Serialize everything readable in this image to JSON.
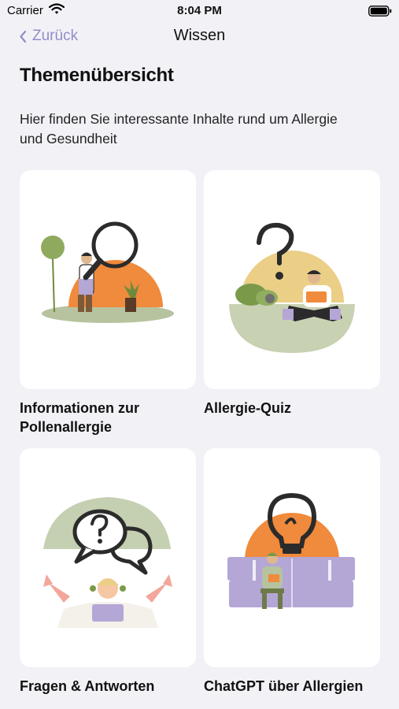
{
  "status_bar": {
    "carrier": "Carrier",
    "time": "8:04 PM"
  },
  "nav": {
    "back_label": "Zurück",
    "title": "Wissen"
  },
  "header": {
    "title": "Themenübersicht",
    "subtitle": "Hier finden Sie interessante Inhalte rund um Allergie und Gesundheit"
  },
  "cards": [
    {
      "label": "Informationen zur Pollenallergie",
      "icon": "magnifier-illustration"
    },
    {
      "label": "Allergie-Quiz",
      "icon": "question-mark-reading-illustration"
    },
    {
      "label": "Fragen & Antworten",
      "icon": "speech-bubbles-illustration"
    },
    {
      "label": "ChatGPT über Allergien",
      "icon": "lightbulb-sofa-illustration"
    }
  ],
  "colors": {
    "accent": "#8e8ec9",
    "background": "#f2f1f6",
    "orange": "#f08a3c",
    "sage": "#b6c39e",
    "dark": "#2b2b2b",
    "lavender": "#b4a7d6",
    "yellow": "#ebcf86"
  }
}
